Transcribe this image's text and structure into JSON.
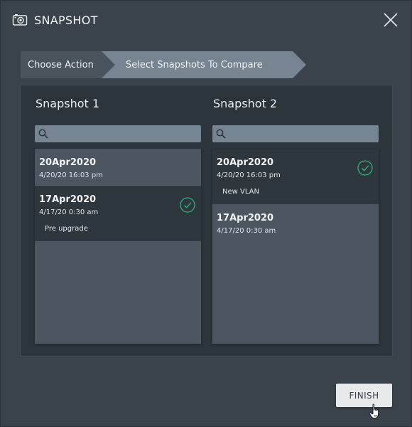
{
  "dialog": {
    "title": "SNAPSHOT",
    "icons": {
      "camera": "camera-icon",
      "close": "close-icon"
    }
  },
  "stepper": {
    "steps": [
      {
        "label": "Choose Action",
        "active": false
      },
      {
        "label": "Select Snapshots To Compare",
        "active": true
      }
    ]
  },
  "columns": [
    {
      "title": "Snapshot 1",
      "search_placeholder": "",
      "items": [
        {
          "name": "20Apr2020",
          "date": "4/20/20 16:03 pm",
          "note": "",
          "selected": false
        },
        {
          "name": "17Apr2020",
          "date": "4/17/20 0:30 am",
          "note": "Pre upgrade",
          "selected": true
        }
      ]
    },
    {
      "title": "Snapshot 2",
      "search_placeholder": "",
      "items": [
        {
          "name": "20Apr2020",
          "date": "4/20/20 16:03 pm",
          "note": "New VLAN",
          "selected": true
        },
        {
          "name": "17Apr2020",
          "date": "4/17/20 0:30 am",
          "note": "",
          "selected": false
        }
      ]
    }
  ],
  "footer": {
    "finish_label": "FINISH"
  },
  "colors": {
    "background": "#3a434b",
    "panel": "#2c343b",
    "list": "#4b5660",
    "selected_item": "#2f373e",
    "active_step": "#768591",
    "check": "#2fb27a"
  }
}
